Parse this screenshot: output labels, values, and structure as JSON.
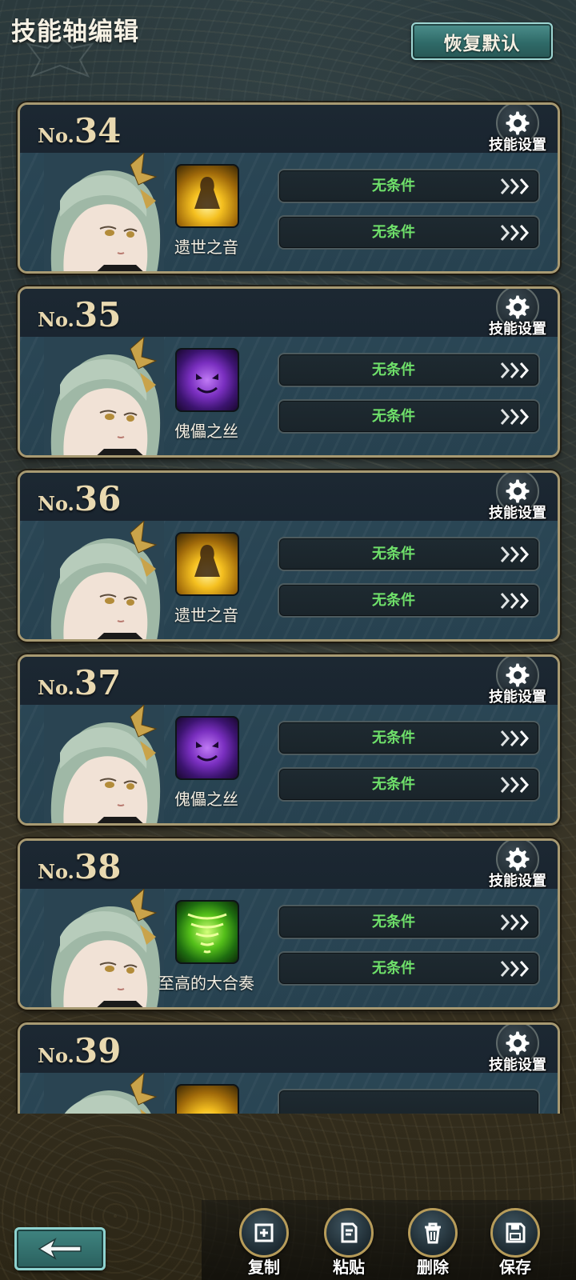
{
  "header": {
    "title": "技能轴编辑",
    "reset_label": "恢复默认"
  },
  "cards": [
    {
      "prefix": "No.",
      "number": "34",
      "settings_label": "技能设置",
      "skill_name": "遗世之音",
      "skill_icon": "golden-figure-skill-icon",
      "condition1": "无条件",
      "condition2": "无条件"
    },
    {
      "prefix": "No.",
      "number": "35",
      "settings_label": "技能设置",
      "skill_name": "傀儡之丝",
      "skill_icon": "purple-mask-skill-icon",
      "condition1": "无条件",
      "condition2": "无条件"
    },
    {
      "prefix": "No.",
      "number": "36",
      "settings_label": "技能设置",
      "skill_name": "遗世之音",
      "skill_icon": "golden-figure-skill-icon",
      "condition1": "无条件",
      "condition2": "无条件"
    },
    {
      "prefix": "No.",
      "number": "37",
      "settings_label": "技能设置",
      "skill_name": "傀儡之丝",
      "skill_icon": "purple-mask-skill-icon",
      "condition1": "无条件",
      "condition2": "无条件"
    },
    {
      "prefix": "No.",
      "number": "38",
      "settings_label": "技能设置",
      "skill_name": "至高的大合奏",
      "skill_icon": "green-tornado-skill-icon",
      "condition1": "无条件",
      "condition2": "无条件"
    },
    {
      "prefix": "No.",
      "number": "39",
      "settings_label": "技能设置",
      "skill_name": "",
      "skill_icon": "golden-figure-skill-icon",
      "condition1": "",
      "condition2": ""
    }
  ],
  "actions": {
    "copy": "复制",
    "paste": "粘贴",
    "delete": "删除",
    "save": "保存"
  },
  "colors": {
    "condition_text": "#6fe06a",
    "card_border": "#a89a72",
    "button_teal": "#2f6a68"
  }
}
